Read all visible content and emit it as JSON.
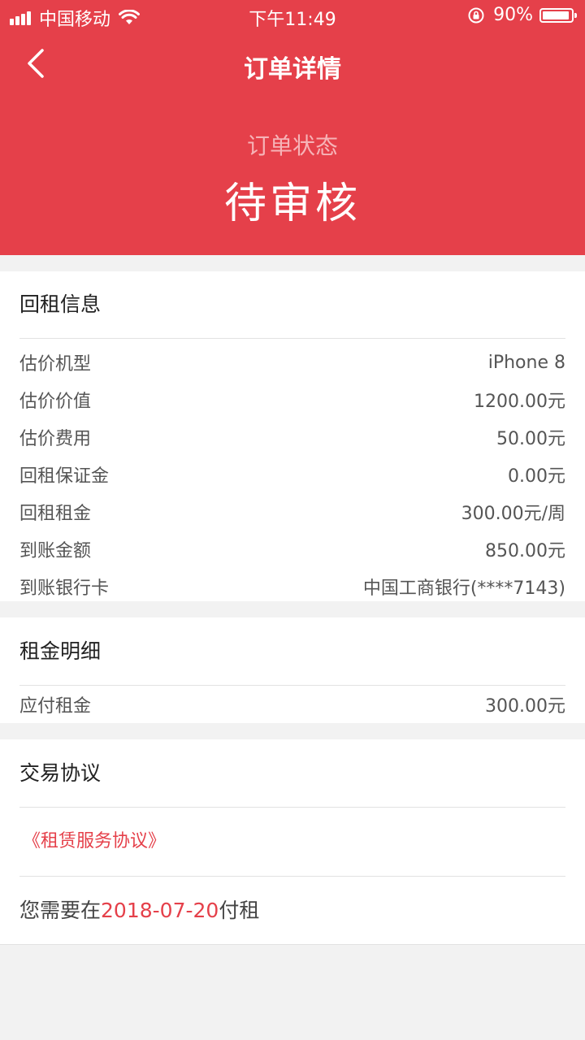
{
  "statusbar": {
    "carrier": "中国移动",
    "time": "下午11:49",
    "battery": "90%"
  },
  "nav": {
    "title": "订单详情"
  },
  "order": {
    "status_label": "订单状态",
    "status_value": "待审核"
  },
  "huizu": {
    "title": "回租信息",
    "rows": [
      {
        "label": "估价机型",
        "value": "iPhone 8"
      },
      {
        "label": "估价价值",
        "value": "1200.00元"
      },
      {
        "label": "估价费用",
        "value": "50.00元"
      },
      {
        "label": "回租保证金",
        "value": "0.00元"
      },
      {
        "label": "回租租金",
        "value": "300.00元/周"
      },
      {
        "label": "到账金额",
        "value": "850.00元"
      },
      {
        "label": "到账银行卡",
        "value": "中国工商银行(****7143)"
      }
    ]
  },
  "rent_detail": {
    "title": "租金明细",
    "rows": [
      {
        "label": "应付租金",
        "value": "300.00元"
      }
    ]
  },
  "agreement": {
    "title": "交易协议",
    "link": "《租赁服务协议》",
    "due_prefix": "您需要在",
    "due_date": "2018-07-20",
    "due_suffix": "付租"
  },
  "colors": {
    "accent": "#e5404a",
    "background": "#f2f2f2"
  },
  "icons": {
    "back": "back-arrow-icon",
    "wifi": "wifi-icon",
    "lock": "rotation-lock-icon",
    "battery": "battery-icon"
  }
}
